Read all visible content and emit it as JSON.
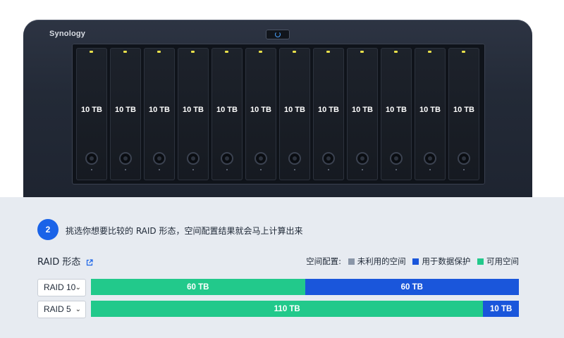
{
  "device": {
    "brand": "Synology",
    "bays": [
      {
        "capacity": "10 TB"
      },
      {
        "capacity": "10 TB"
      },
      {
        "capacity": "10 TB"
      },
      {
        "capacity": "10 TB"
      },
      {
        "capacity": "10 TB"
      },
      {
        "capacity": "10 TB"
      },
      {
        "capacity": "10 TB"
      },
      {
        "capacity": "10 TB"
      },
      {
        "capacity": "10 TB"
      },
      {
        "capacity": "10 TB"
      },
      {
        "capacity": "10 TB"
      },
      {
        "capacity": "10 TB"
      }
    ]
  },
  "step": {
    "number": "2",
    "text": "挑选你想要比较的 RAID 形态，空间配置结果就会马上计算出来"
  },
  "raid_section": {
    "title": "RAID 形态",
    "legend_label": "空间配置:",
    "legend": [
      {
        "label": "未利用的空间",
        "color": "#8a96a8"
      },
      {
        "label": "用于数据保护",
        "color": "#1a56db"
      },
      {
        "label": "可用空间",
        "color": "#22c98b"
      }
    ],
    "rows": [
      {
        "selected": "RAID 10",
        "segments": [
          {
            "label": "60 TB",
            "kind": "可用空间",
            "value": 60,
            "color": "#22c98b"
          },
          {
            "label": "60 TB",
            "kind": "用于数据保护",
            "value": 60,
            "color": "#1a56db"
          }
        ]
      },
      {
        "selected": "RAID 5",
        "segments": [
          {
            "label": "110 TB",
            "kind": "可用空间",
            "value": 110,
            "color": "#22c98b"
          },
          {
            "label": "10 TB",
            "kind": "用于数据保护",
            "value": 10,
            "color": "#1a56db"
          }
        ]
      }
    ]
  }
}
